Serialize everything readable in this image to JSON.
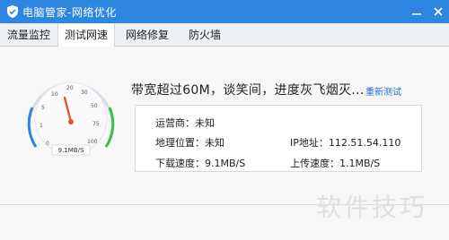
{
  "window": {
    "title": "电脑管家-网络优化",
    "accent_color": "#2f86e0",
    "logo_icon": "shield-icon",
    "buttons": [
      {
        "name": "minimize",
        "icon": "minimize-icon"
      },
      {
        "name": "close",
        "icon": "close-icon"
      }
    ]
  },
  "tabs": [
    {
      "label": "流量监控",
      "active": false
    },
    {
      "label": "测试网速",
      "active": true
    },
    {
      "label": "网络修复",
      "active": false
    },
    {
      "label": "防火墙",
      "active": false
    }
  ],
  "gauge": {
    "ticks": [
      "0",
      "1",
      "5",
      "10",
      "20",
      "30",
      "50",
      "75",
      "100"
    ],
    "speed_label": "9.1MB/S"
  },
  "result": {
    "headline": "带宽超过60M，谈笑间，进度灰飞烟灭...",
    "retest_link": "重新测试"
  },
  "info": {
    "isp": "运营商：未知",
    "location": "地理位置：未知",
    "ip": "IP地址：112.51.54.110",
    "download": "下载速度：9.1MB/S",
    "upload": "上传速度：1.1MB/S"
  },
  "watermark": "软件技巧"
}
